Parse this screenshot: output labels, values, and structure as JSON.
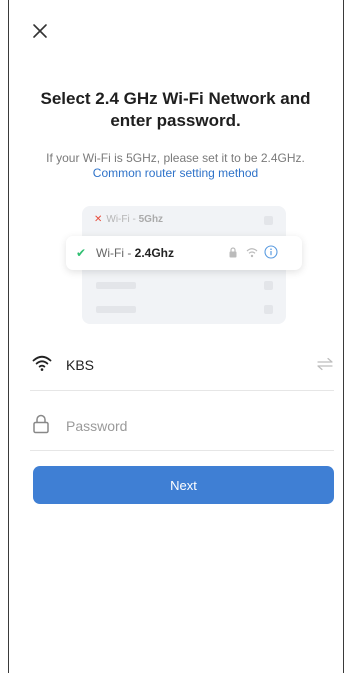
{
  "header": {
    "close_icon": "close-icon"
  },
  "title": "Select 2.4 GHz Wi-Fi Network and enter password.",
  "subtitle": "If your Wi-Fi is 5GHz, please set it to be 2.4GHz.",
  "link": "Common router setting method",
  "illustration": {
    "row_bad": {
      "prefix": "Wi-Fi - ",
      "band": "5Ghz"
    },
    "row_good": {
      "prefix": "Wi-Fi - ",
      "band": "2.4Ghz"
    }
  },
  "form": {
    "network_name": "KBS",
    "password_placeholder": "Password",
    "password_value": ""
  },
  "next_label": "Next",
  "colors": {
    "accent": "#3f7fd4",
    "link": "#2f73c9",
    "ok": "#2fbf71",
    "bad": "#e74c3c"
  }
}
